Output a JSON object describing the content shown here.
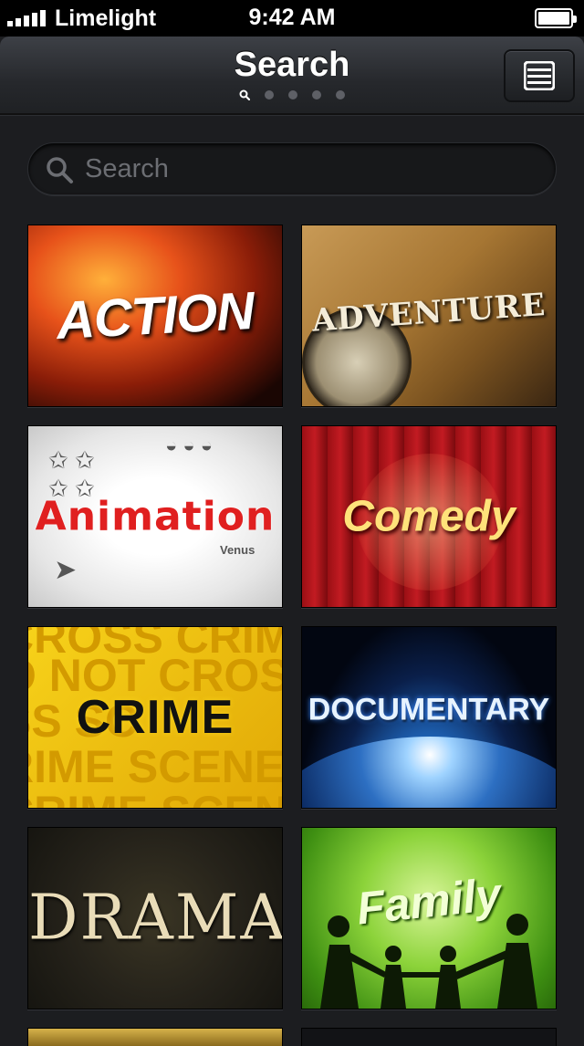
{
  "status_bar": {
    "carrier": "Limelight",
    "time": "9:42 AM",
    "battery_level": 1.0
  },
  "nav": {
    "title": "Search",
    "pages": 5,
    "current_page": 1
  },
  "search": {
    "placeholder": "Search",
    "value": ""
  },
  "genres": [
    {
      "label": "ACTION"
    },
    {
      "label": "ADVENTURE"
    },
    {
      "label": "Animation"
    },
    {
      "label": "Comedy"
    },
    {
      "label": "CRIME"
    },
    {
      "label": "DOCUMENTARY"
    },
    {
      "label": "DRAMA"
    },
    {
      "label": "Family"
    }
  ],
  "crime_background_text": [
    "CROSS CRIME",
    "O NOT CROSS",
    "SS     SC",
    "RIME SCENE D",
    "CRIME SCENE"
  ],
  "animation_doodle": "Venus",
  "colors": {
    "status_bar": "#000000",
    "nav_bar": "#2f3237",
    "background": "#1c1d20",
    "search_field": "#17181a"
  }
}
